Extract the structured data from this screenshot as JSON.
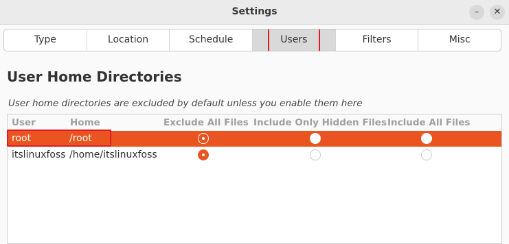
{
  "window": {
    "title": "Settings",
    "minimize_icon": "minimize-icon",
    "close_icon": "close-icon"
  },
  "tabs": [
    {
      "label": "Type"
    },
    {
      "label": "Location"
    },
    {
      "label": "Schedule"
    },
    {
      "label": "Users",
      "active": true
    },
    {
      "label": "Filters"
    },
    {
      "label": "Misc"
    }
  ],
  "section": {
    "title": "User Home Directories",
    "note": "User home directories are excluded by default unless you enable them here"
  },
  "table": {
    "columns": [
      "User",
      "Home",
      "Exclude All Files",
      "Include Only Hidden Files",
      "Include All Files"
    ],
    "rows": [
      {
        "user": "root",
        "home": "/root",
        "choice": "Exclude All Files",
        "selected": true
      },
      {
        "user": "itslinuxfoss",
        "home": "/home/itslinuxfoss",
        "choice": "Exclude All Files",
        "selected": false
      }
    ]
  },
  "colors": {
    "accent": "#e95420",
    "highlight_outline": "#e01b24"
  }
}
